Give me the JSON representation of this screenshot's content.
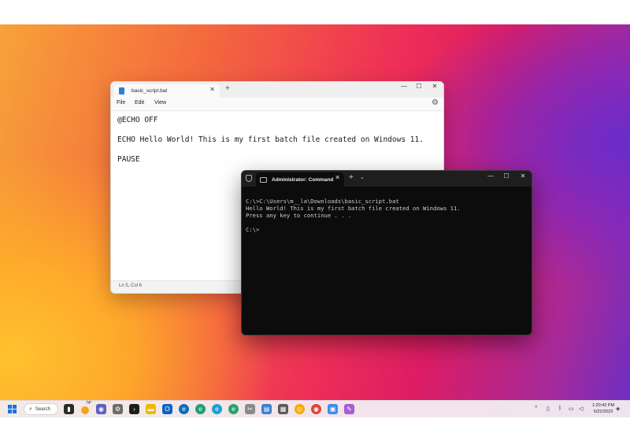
{
  "notepad": {
    "tab_title": "basic_script.bat",
    "menu": [
      "File",
      "Edit",
      "View"
    ],
    "lines": [
      "@ECHO OFF",
      "ECHO Hello World! This is my first batch file created on Windows 11.",
      "PAUSE"
    ],
    "status": "Ln 5, Col 6",
    "icons": {
      "close": "close-icon",
      "new_tab": "plus-icon",
      "minimize": "minimize-icon",
      "maximize": "maximize-icon",
      "settings": "gear-icon"
    }
  },
  "terminal": {
    "tab_title": "Administrator: Command Pro",
    "lines": [
      "C:\\>C:\\Users\\m__la\\Downloads\\basic_script.bat",
      "Hello World! This is my first batch file created on Windows 11.",
      "Press any key to continue . . .",
      "",
      "C:\\>"
    ]
  },
  "taskbar": {
    "search_label": "Search",
    "weather_temp": "74°",
    "time": "1:20:42 PM",
    "date": "5/22/2023",
    "apps": [
      "file-explorer",
      "chat",
      "settings",
      "terminal",
      "file-explorer-2",
      "outlook",
      "edge",
      "edge-beta",
      "edge-dev",
      "edge-canary",
      "snipping-tool",
      "notepad",
      "calculator",
      "canary-browser",
      "chrome",
      "photos",
      "paint"
    ]
  },
  "colors": {
    "terminal_bg": "#0c0c0c",
    "notepad_bg": "#ffffff",
    "accent": "#1a73d9"
  }
}
